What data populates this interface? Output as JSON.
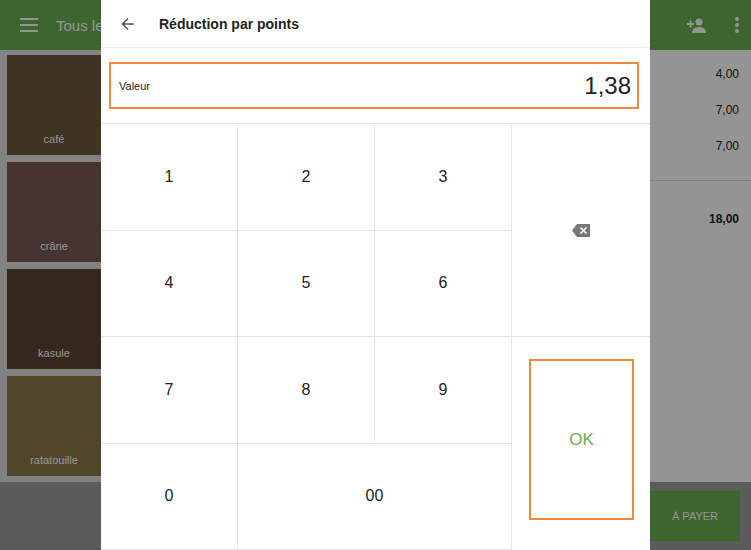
{
  "app_bar": {
    "title": "Tous le"
  },
  "products": [
    {
      "name": "café",
      "color": "#6b5a3a"
    },
    {
      "name": "crâne",
      "color": "#7a5a55"
    },
    {
      "name": "kasule",
      "color": "#5e4636"
    },
    {
      "name": "ratatouille",
      "color": "#8a7a4a"
    }
  ],
  "order": {
    "amounts": [
      "4,00",
      "7,00",
      "7,00"
    ],
    "total": "18,00"
  },
  "pay_button": "À PAYER",
  "dialog": {
    "title": "Réduction par points",
    "field": {
      "label": "Valeur",
      "value": "1,38"
    },
    "keys": [
      "1",
      "2",
      "3",
      "4",
      "5",
      "6",
      "7",
      "8",
      "9",
      "0",
      "00"
    ],
    "ok": "OK"
  }
}
